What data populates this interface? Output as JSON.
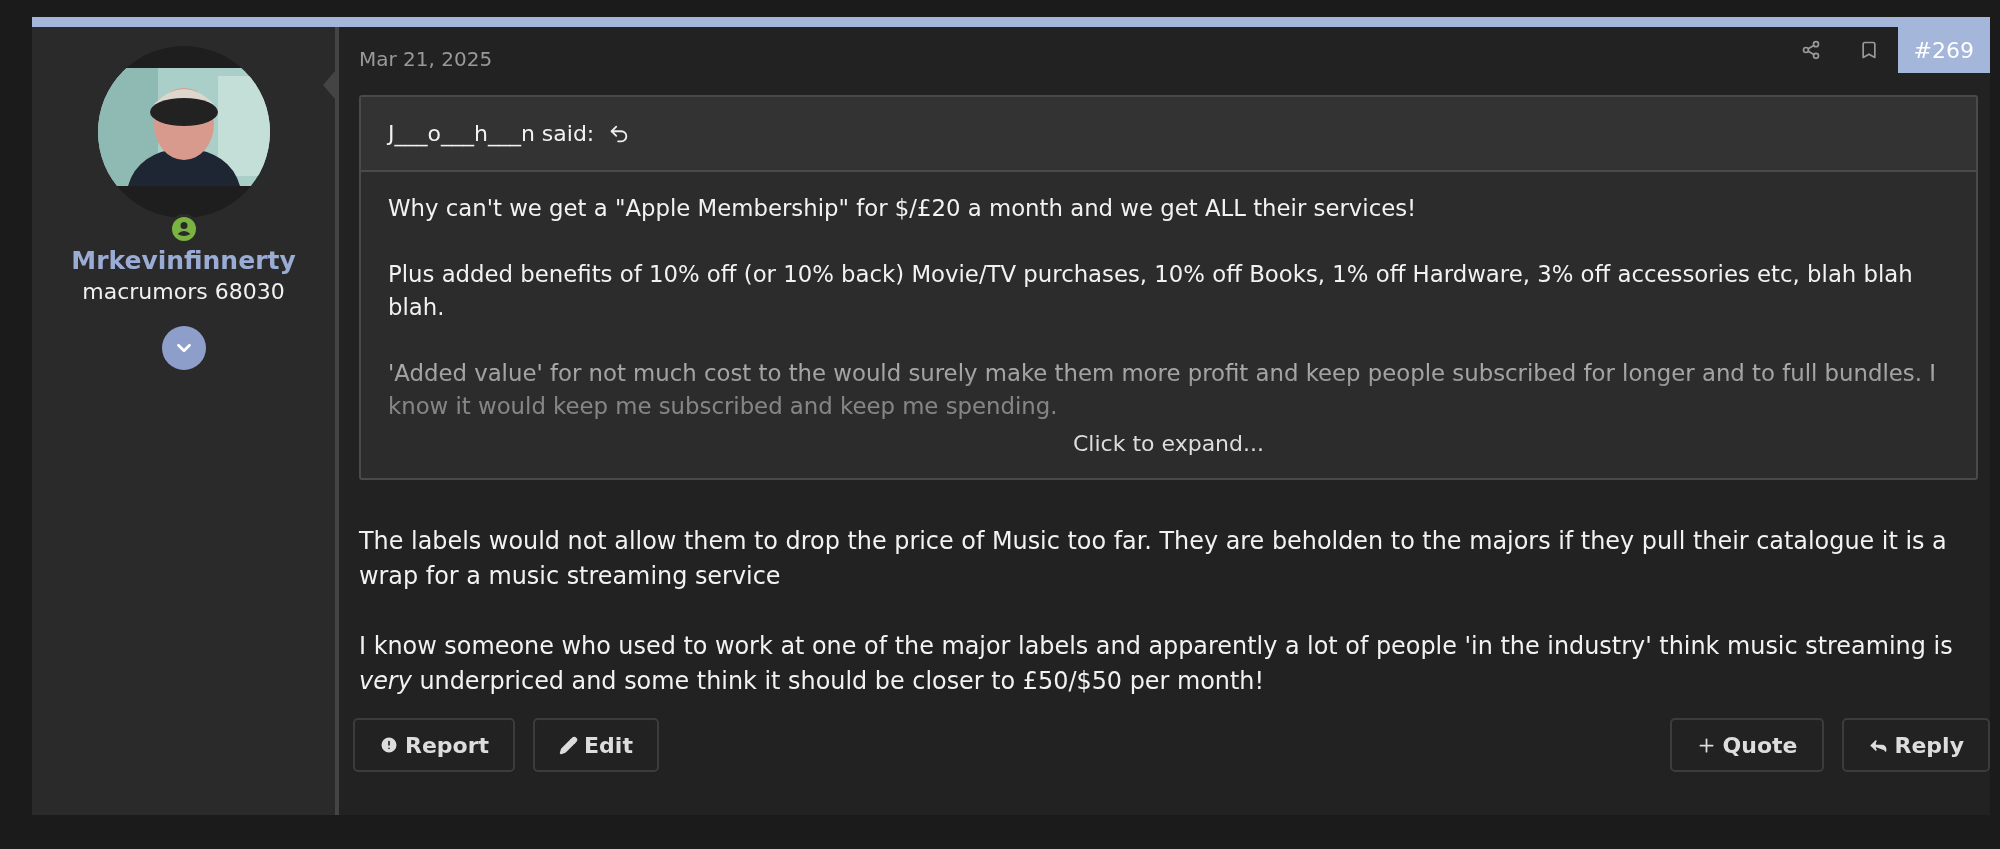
{
  "post": {
    "date": "Mar 21, 2025",
    "number": "#269"
  },
  "author": {
    "name": "Mrkevinfinnerty",
    "title": "macrumors 68030",
    "online": true
  },
  "quote": {
    "attribution": "J___o___h___n said:",
    "paragraphs": [
      "Why can't we get a \"Apple Membership\" for $/£20 a month and we get ALL their services!",
      "Plus added benefits of 10% off (or 10% back) Movie/TV purchases, 10% off Books, 1% off Hardware, 3% off accessories etc, blah blah blah.",
      "'Added value' for not much cost to the would surely make them more profit and keep people subscribed for longer and to full bundles. I know it would keep me subscribed and keep me spending."
    ],
    "expand": "Click to expand..."
  },
  "body": {
    "paragraphs": [
      "The labels would not allow them to drop the price of Music too far. They are beholden to the majors if they pull their catalogue it is a wrap for a music streaming service",
      "I know someone who used to work at one of the major labels and apparently a lot of people 'in the industry' think music streaming is *very* underpriced and some think it should be closer to £50/$50 per month!"
    ]
  },
  "actions_left": [
    {
      "kind": "report",
      "label": "Report"
    },
    {
      "kind": "edit",
      "label": "Edit"
    }
  ],
  "actions_right": [
    {
      "kind": "quote",
      "label": "Quote"
    },
    {
      "kind": "reply",
      "label": "Reply"
    }
  ]
}
